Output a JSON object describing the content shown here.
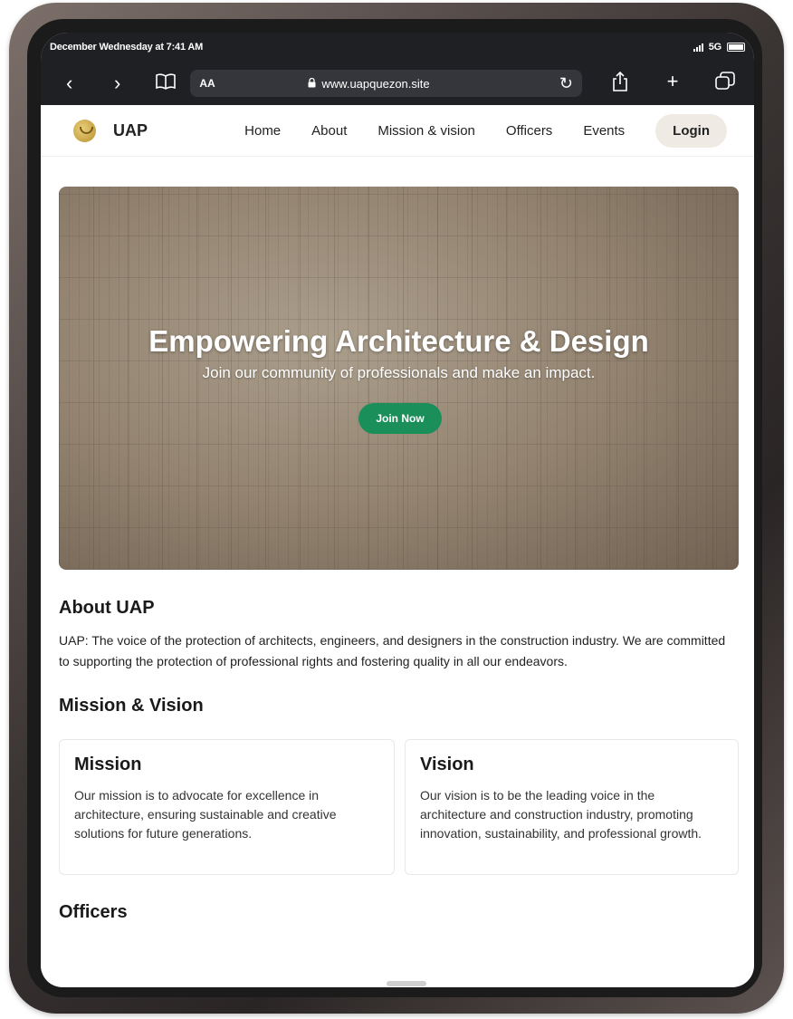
{
  "status_bar": {
    "datetime": "December Wednesday at 7:41 AM",
    "network": "5G"
  },
  "browser": {
    "text_size_label": "AA",
    "url": "www.uapquezon.site"
  },
  "site_nav": {
    "brand": "UAP",
    "links": [
      "Home",
      "About",
      "Mission & vision",
      "Officers",
      "Events"
    ],
    "login_label": "Login"
  },
  "hero": {
    "title": "Empowering Architecture & Design",
    "subtitle": "Join our community of professionals and make an impact.",
    "cta_label": "Join Now"
  },
  "about": {
    "heading": "About UAP",
    "body": "UAP: The voice of the protection of architects, engineers, and designers in the construction industry. We are committed to supporting the protection of professional rights and fostering quality in all our endeavors."
  },
  "mission_vision": {
    "heading": "Mission & Vision",
    "mission_title": "Mission",
    "mission_text": "Our mission is to advocate for excellence in architecture, ensuring sustainable and creative solutions for future generations.",
    "vision_title": "Vision",
    "vision_text": "Our vision is to be the leading voice in the architecture and construction industry, promoting innovation, sustainability, and professional growth."
  },
  "officers": {
    "heading": "Officers"
  },
  "colors": {
    "cta_green": "#1a8f5a",
    "browser_chrome": "#1f2023",
    "login_bg": "#efebe4"
  }
}
